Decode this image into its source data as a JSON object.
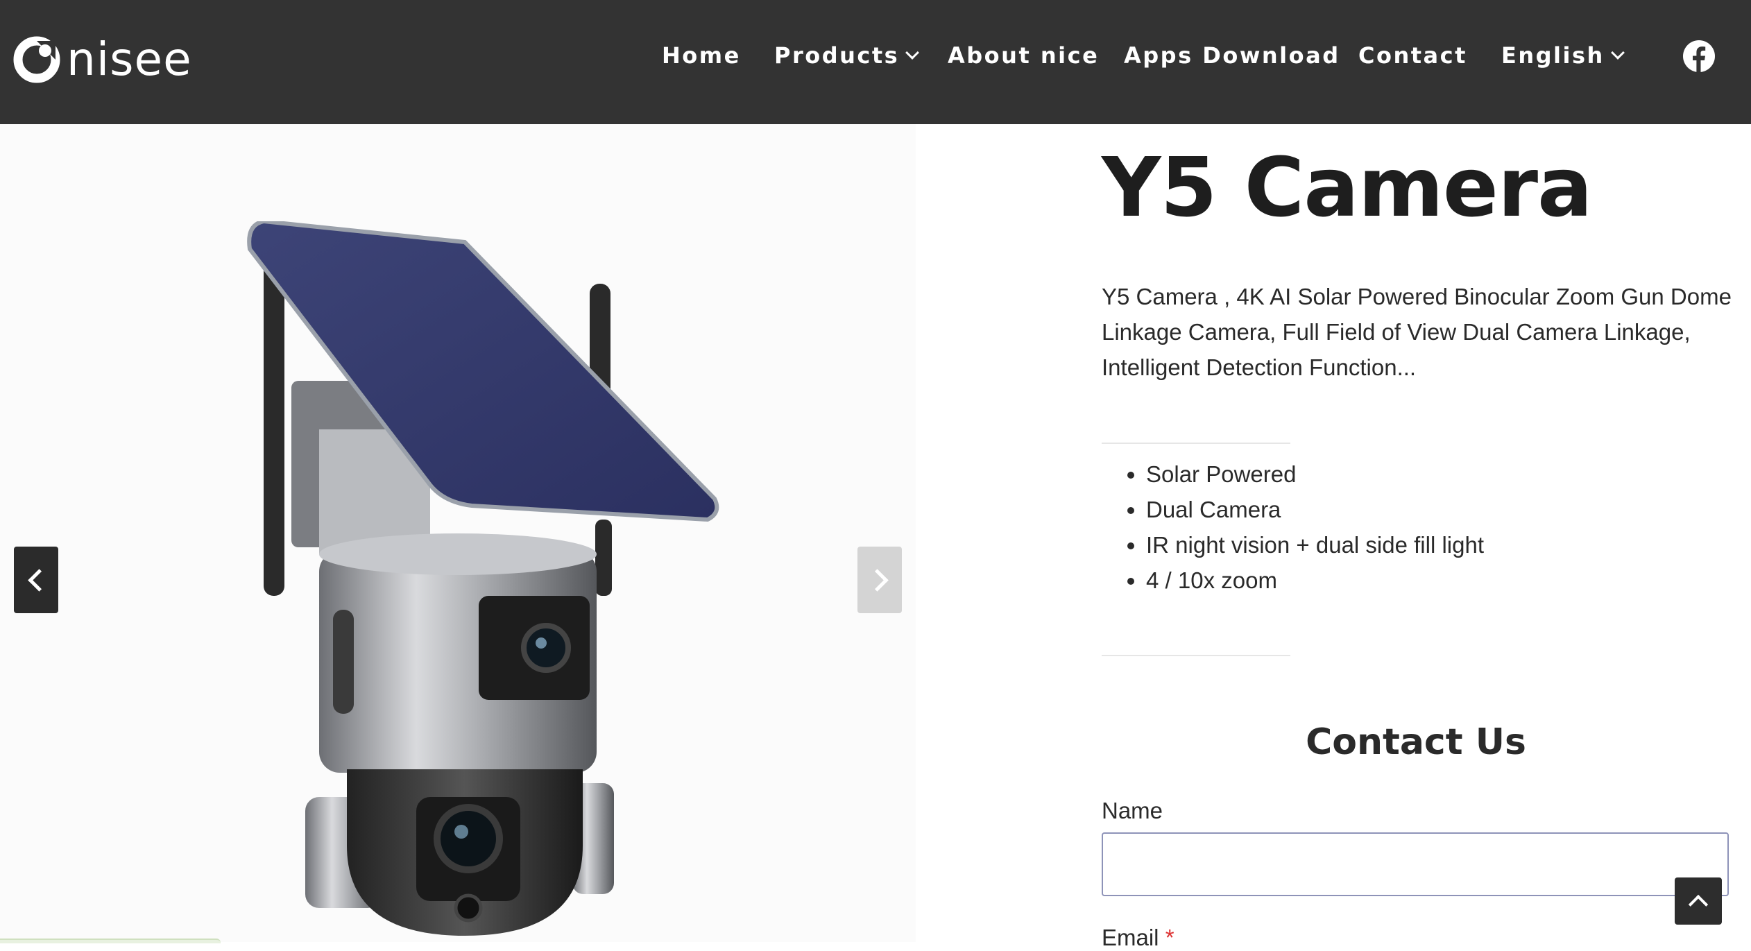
{
  "brand": {
    "name": "nisee"
  },
  "nav": {
    "items": [
      {
        "label": "Home"
      },
      {
        "label": "Products",
        "has_dropdown": true
      },
      {
        "label": "About nice"
      },
      {
        "label": "Apps Download"
      },
      {
        "label": "Contact"
      },
      {
        "label": "English",
        "has_dropdown": true
      }
    ],
    "social_icon": "facebook-icon"
  },
  "gallery": {
    "prev_icon": "chevron-left-icon",
    "next_icon": "chevron-right-icon"
  },
  "product": {
    "title": "Y5 Camera",
    "description": "Y5 Camera , 4K AI Solar Powered Binocular Zoom Gun Dome Linkage Camera, Full Field of View Dual Camera Linkage, Intelligent Detection Function...",
    "features": [
      "Solar Powered",
      "Dual Camera",
      "IR night vision + dual side fill light",
      "4 / 10x zoom"
    ]
  },
  "contact": {
    "title": "Contact Us",
    "name_label": "Name",
    "name_value": "",
    "email_label": "Email",
    "required_mark": "*"
  },
  "colors": {
    "header_bg": "#333333",
    "accent_required": "#dd3333"
  }
}
